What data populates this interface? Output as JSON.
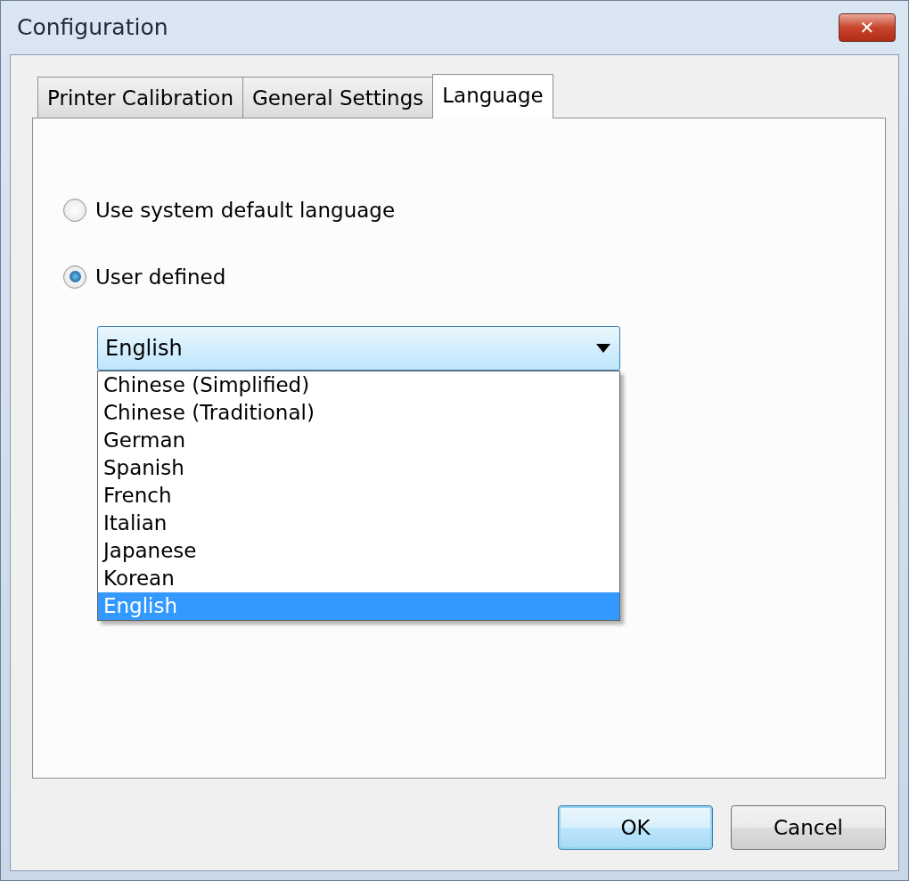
{
  "window": {
    "title": "Configuration",
    "close": "✕"
  },
  "tabs": [
    {
      "label": "Printer Calibration",
      "selected": false
    },
    {
      "label": "General Settings",
      "selected": false
    },
    {
      "label": "Language",
      "selected": true
    }
  ],
  "options": [
    {
      "label": "Use system default language",
      "selected": false
    },
    {
      "label": "User defined",
      "selected": true
    }
  ],
  "dropdown": {
    "value": "English",
    "expanded": true,
    "items": [
      {
        "label": "Chinese (Simplified)",
        "selected": false
      },
      {
        "label": "Chinese (Traditional)",
        "selected": false
      },
      {
        "label": "German",
        "selected": false
      },
      {
        "label": "Spanish",
        "selected": false
      },
      {
        "label": "French",
        "selected": false
      },
      {
        "label": "Italian",
        "selected": false
      },
      {
        "label": "Japanese",
        "selected": false
      },
      {
        "label": "Korean",
        "selected": false
      },
      {
        "label": "English",
        "selected": true
      }
    ]
  },
  "buttons": [
    {
      "label": "OK",
      "kind": "default"
    },
    {
      "label": "Cancel",
      "kind": "normal"
    }
  ]
}
